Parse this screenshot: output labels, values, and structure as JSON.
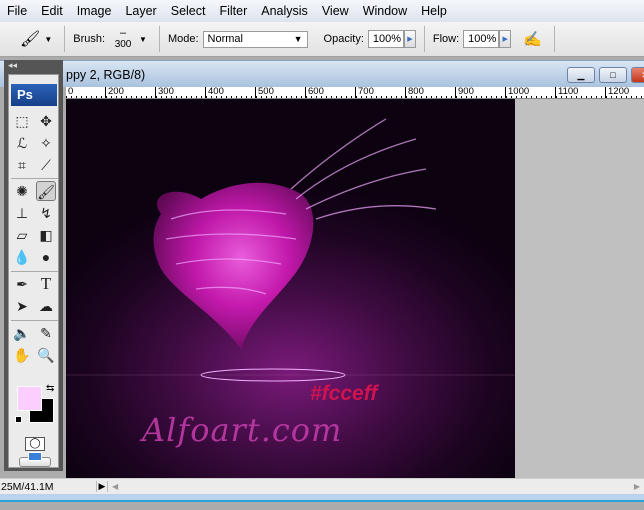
{
  "menu": [
    "File",
    "Edit",
    "Image",
    "Layer",
    "Select",
    "Filter",
    "Analysis",
    "View",
    "Window",
    "Help"
  ],
  "options": {
    "brush_label": "Brush:",
    "brush_size": "300",
    "mode_label": "Mode:",
    "mode_value": "Normal",
    "opacity_label": "Opacity:",
    "opacity_value": "100%",
    "flow_label": "Flow:",
    "flow_value": "100%"
  },
  "document": {
    "title": "ppy 2, RGB/8)",
    "minimize": "▁",
    "restore": "□",
    "close": "✕"
  },
  "ruler": [
    "0",
    "200",
    "300",
    "400",
    "500",
    "600",
    "700",
    "800",
    "900",
    "1000",
    "1100",
    "1200"
  ],
  "toolbox": {
    "logo": "Ps",
    "collapse": "◂◂",
    "foreground_color": "#fcceff",
    "background_color": "#000000"
  },
  "canvas": {
    "color_tag": "#fcceff",
    "watermark": "Alfoart.com"
  },
  "status": {
    "doc_size": "25M/41.1M"
  }
}
